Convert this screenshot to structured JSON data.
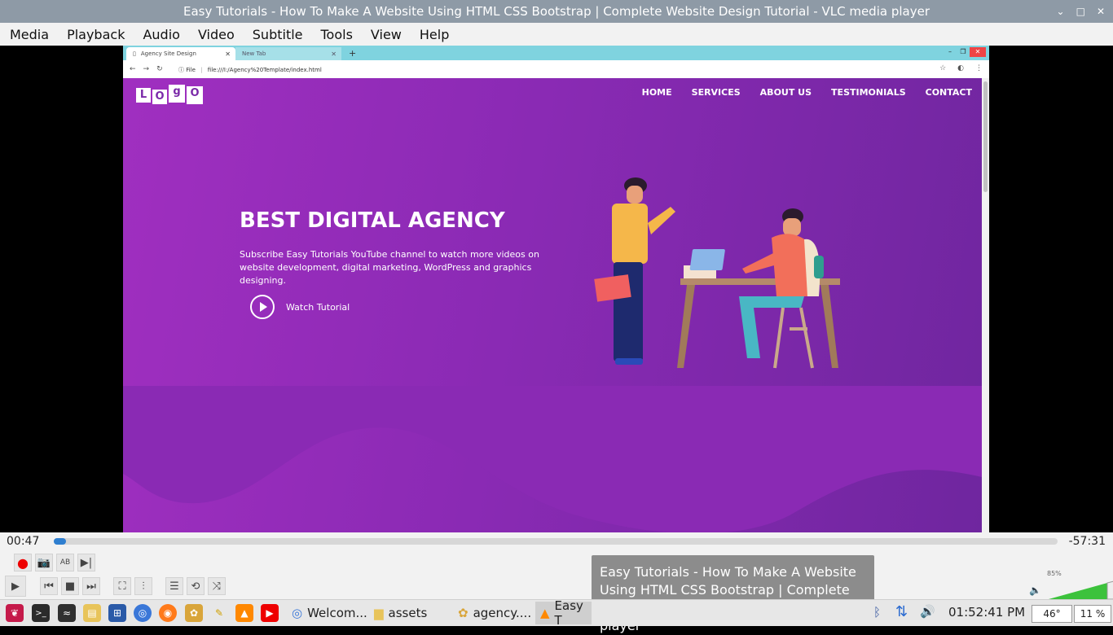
{
  "window": {
    "title": "Easy Tutorials - How To Make A Website Using HTML CSS Bootstrap | Complete Website Design Tutorial - VLC media player",
    "controls": [
      "⌄",
      "□",
      "✕"
    ]
  },
  "menu": [
    "Media",
    "Playback",
    "Audio",
    "Video",
    "Subtitle",
    "Tools",
    "View",
    "Help"
  ],
  "browser": {
    "tabs": [
      {
        "label": "Agency Site Design",
        "close": "✕"
      },
      {
        "label": "New Tab",
        "close": "✕"
      }
    ],
    "new_tab": "+",
    "url_prefix": "File",
    "url": "file:///I:/Agency%20Template/index.html"
  },
  "site": {
    "logo_letters": [
      "L",
      "O",
      "g",
      "O"
    ],
    "nav": [
      "HOME",
      "SERVICES",
      "ABOUT US",
      "TESTIMONIALS",
      "CONTACT"
    ],
    "headline": "BEST DIGITAL AGENCY",
    "subtitle": "Subscribe Easy Tutorials YouTube channel to watch more videos on website development, digital marketing, WordPress and graphics designing.",
    "cta": "Watch Tutorial",
    "colors": {
      "hero_start": "#a02fc0",
      "hero_end": "#6f269f"
    }
  },
  "player": {
    "elapsed": "00:47",
    "remaining": "-57:31",
    "progress_fraction": 0.012,
    "volume_percent": "85%"
  },
  "tooltip": "Easy Tutorials - How To Make A Website Using HTML CSS Bootstrap | Complete Website Design Tutorial - VLC media player",
  "taskbar": {
    "tasks": [
      {
        "label": "Welcom...",
        "icon": "chromium-icon"
      },
      {
        "label": "assets",
        "icon": "folder-icon"
      },
      {
        "label": "agency....",
        "icon": "geany-icon"
      },
      {
        "label": "Easy T",
        "icon": "vlc-icon"
      }
    ],
    "clock": "01:52:41 PM",
    "temp": "46°",
    "cpu": "11 %"
  }
}
